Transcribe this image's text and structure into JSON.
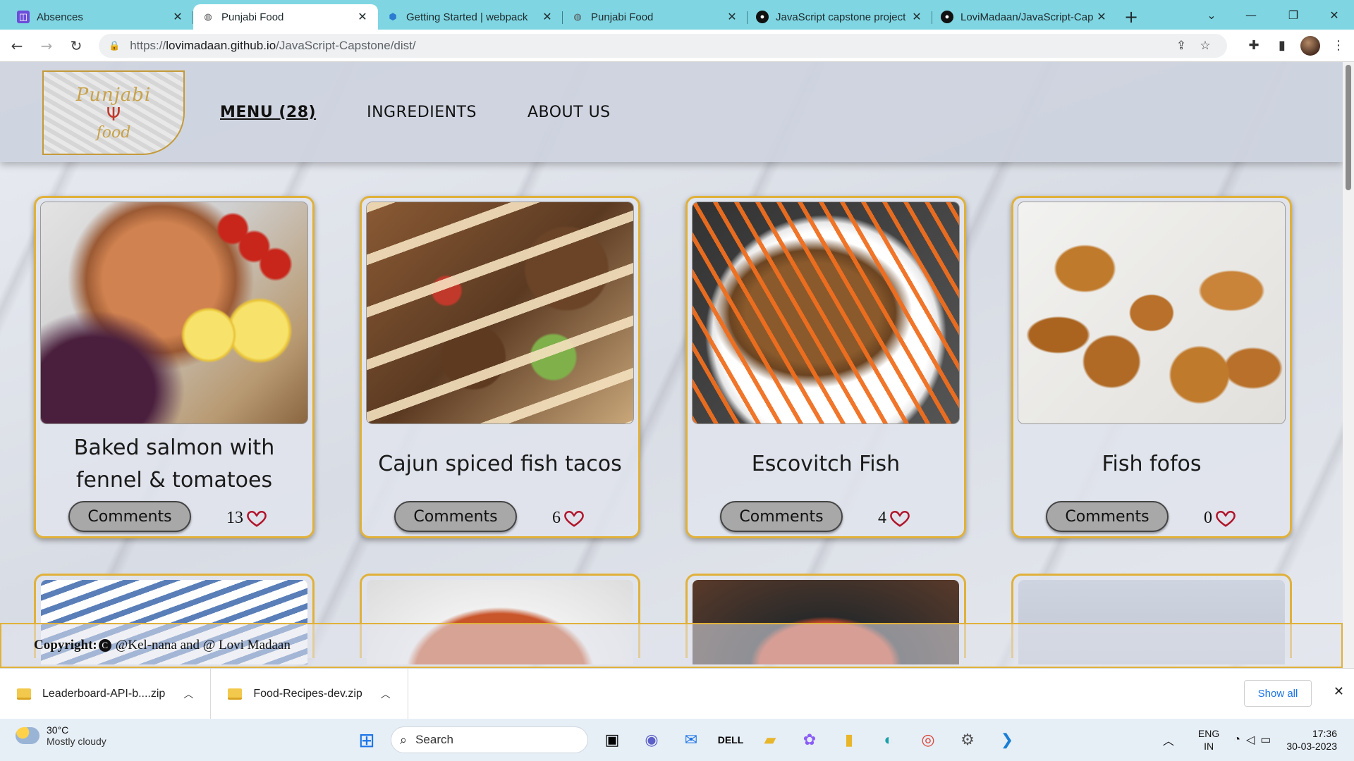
{
  "browser": {
    "tabs": [
      {
        "title": "Absences",
        "icon": "absences-favicon",
        "active": false
      },
      {
        "title": "Punjabi Food",
        "icon": "globe-icon",
        "active": true
      },
      {
        "title": "Getting Started | webpack",
        "icon": "webpack-favicon",
        "active": false
      },
      {
        "title": "Punjabi Food",
        "icon": "globe-icon",
        "active": false
      },
      {
        "title": "JavaScript capstone project",
        "icon": "github-icon",
        "active": false
      },
      {
        "title": "LoviMadaan/JavaScript-Cap",
        "icon": "github-icon",
        "active": false
      }
    ],
    "url_host": "lovimadaan.github.io",
    "url_path": "/JavaScript-Capstone/dist/",
    "url_scheme": "https://"
  },
  "site": {
    "logo_top": "Punjabi",
    "logo_bottom": "food",
    "nav": [
      {
        "label": "MENU (28)",
        "active": true
      },
      {
        "label": "INGREDIENTS",
        "active": false
      },
      {
        "label": "ABOUT US",
        "active": false
      }
    ],
    "cards": [
      {
        "name": "Baked salmon with fennel & tomatoes",
        "comments_label": "Comments",
        "likes": "13"
      },
      {
        "name": "Cajun spiced fish tacos",
        "comments_label": "Comments",
        "likes": "6"
      },
      {
        "name": "Escovitch Fish",
        "comments_label": "Comments",
        "likes": "4"
      },
      {
        "name": "Fish fofos",
        "comments_label": "Comments",
        "likes": "0"
      }
    ],
    "footer": {
      "label": "Copyright:",
      "symbol": "C",
      "text": "@Kel-nana and @ Lovi Madaan"
    }
  },
  "downloads": {
    "items": [
      {
        "name": "Leaderboard-API-b....zip"
      },
      {
        "name": "Food-Recipes-dev.zip"
      }
    ],
    "show_all": "Show all"
  },
  "taskbar": {
    "weather_temp": "30°C",
    "weather_desc": "Mostly cloudy",
    "search_label": "Search",
    "lang_1": "ENG",
    "lang_2": "IN",
    "time": "17:36",
    "date": "30-03-2023"
  },
  "colors": {
    "accent_gold": "#e0b13a",
    "tabbar": "#7fd6e2",
    "heart": "#b0142a"
  }
}
